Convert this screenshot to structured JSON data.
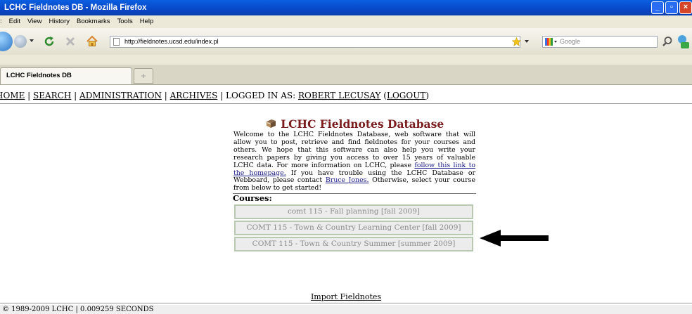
{
  "window": {
    "title": "LCHC Fieldnotes DB - Mozilla Firefox"
  },
  "menu": {
    "items": [
      "Edit",
      "View",
      "History",
      "Bookmarks",
      "Tools",
      "Help"
    ]
  },
  "toolbar": {
    "url": "http://fieldnotes.ucsd.edu/index.pl",
    "search_placeholder": "Google"
  },
  "tabs": [
    {
      "label": "LCHC Fieldnotes DB"
    }
  ],
  "nav": {
    "home": "HOME",
    "search": "SEARCH",
    "administration": "ADMINISTRATION",
    "archives": "ARCHIVES",
    "logged_in_prefix": "LOGGED IN AS:",
    "user": "ROBERT LECUSAY",
    "logout": "LOGOUT"
  },
  "page": {
    "title": "LCHC Fieldnotes Database",
    "intro_text": "Welcome to the LCHC Fieldnotes Database, web software that will allow you to post, retrieve and find fieldnotes for your courses and others. We hope that this software can also help you write your research papers by giving you access to over 15 years of valuable LCHC data. For more information on LCHC, please",
    "homepage_link": "follow this link to the homepage.",
    "trouble_text": "If you have trouble using the LCHC Database or Webboard, please contact",
    "contact_link": "Bruce Jones.",
    "closing_text": "Otherwise, select your course from below to get started!",
    "courses_label": "Courses:",
    "courses": [
      "comt 115 - Fall planning [fall 2009]",
      "COMT 115 - Town & Country Learning Center [fall 2009]",
      "COMT 115 - Town & Country Summer [summer 2009]"
    ],
    "import_link": "Import Fieldnotes"
  },
  "footer": {
    "text": "© 1989-2009 LCHC | 0.009259 SECONDS"
  },
  "colors": {
    "title_bar": "#0a5fe0",
    "page_title": "#7b1c1c",
    "course_border": "#b9c8b1",
    "arrow": "#000000"
  },
  "icons": [
    "back-icon",
    "forward-icon",
    "reload-icon",
    "stop-icon",
    "home-icon",
    "page-icon",
    "star-icon",
    "google-icon",
    "magnifier-icon",
    "book-icon",
    "arrow-icon"
  ]
}
